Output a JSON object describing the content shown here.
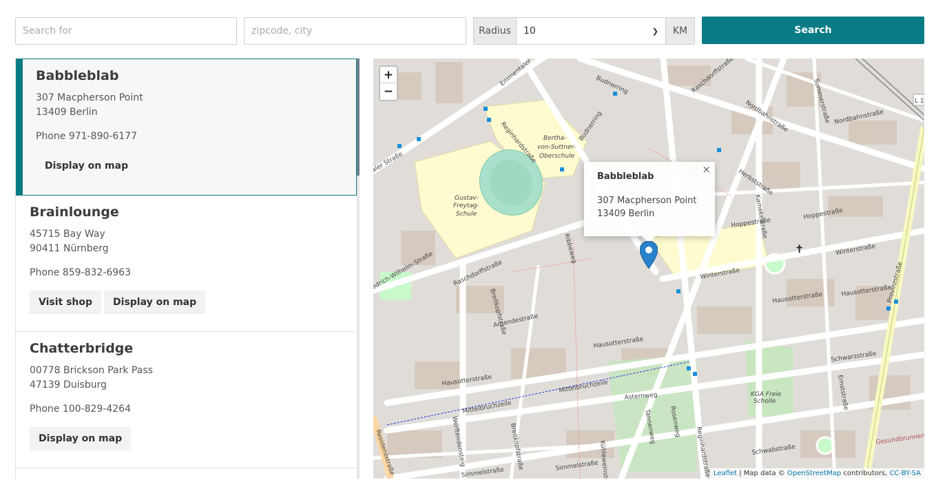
{
  "search": {
    "query_placeholder": "Search for",
    "location_placeholder": "zipcode, city",
    "radius_label": "Radius",
    "radius_value": "10",
    "radius_unit": "KM",
    "search_button": "Search"
  },
  "stores": [
    {
      "name": "Babbleblab",
      "street": "307 Macpherson Point",
      "city": "13409 Berlin",
      "phone": "Phone 971-890-6177",
      "display_label": "Display on map"
    },
    {
      "name": "Brainlounge",
      "street": "45715 Bay Way",
      "city": "90411 Nürnberg",
      "phone": "Phone 859-832-6963",
      "visit_label": "Visit shop",
      "display_label": "Display on map"
    },
    {
      "name": "Chatterbridge",
      "street": "00778 Brickson Park Pass",
      "city": "47139 Duisburg",
      "phone": "Phone 100-829-4264",
      "display_label": "Display on map"
    }
  ],
  "map": {
    "zoom_in": "+",
    "zoom_out": "−",
    "popup": {
      "title": "Babbleblab",
      "street": "307 Macpherson Point",
      "city": "13409 Berlin",
      "close": "×"
    },
    "attribution": {
      "leaflet": "Leaflet",
      "separator": "| Map data ©",
      "osm": "OpenStreetMap",
      "contributors": "contributors,",
      "license": "CC-BY-SA"
    },
    "streets": [
      "Budnerring",
      "Raschdorffstraße",
      "Nordbahnstraße",
      "Reginhardstraße",
      "Emmentaler Straße",
      "Herbststraße",
      "Hoppestraße",
      "Winterstraße",
      "Kamekestraße",
      "Provinzstraße",
      "Hausotterstraße",
      "Amendestraße",
      "Breitkopfstraße",
      "Mittelbruchzeile",
      "Schwarzstraße",
      "Schwabstraße",
      "Simmelstraße",
      "Gesundbrunnen",
      "Residenzstraße",
      "Friedrich-Wilhelm-Straße",
      "Sommerstraße",
      "Ribbeweg",
      "Asternweg",
      "Rosenweg",
      "Tannenweg",
      "Kühleweinstraße"
    ],
    "labels": [
      "Bertha-von-Suttner-Oberschule",
      "Gustav-Freytag-Schule",
      "KGA Freie Scholle",
      "L 1"
    ],
    "colors": {
      "accent": "#087b84",
      "marker": "#2a81cb",
      "park": "#c8facc",
      "school": "#ffffe5",
      "road": "#ffffff"
    }
  }
}
